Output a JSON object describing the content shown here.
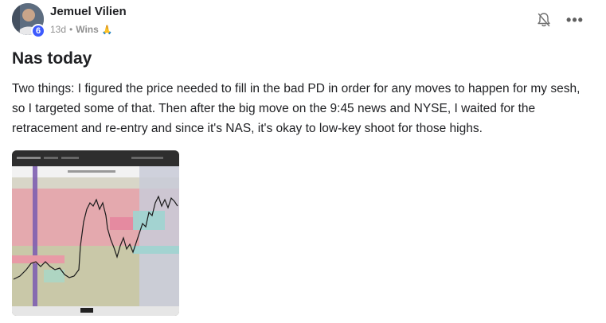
{
  "post": {
    "author": {
      "name": "Jemuel Vilien",
      "level": "6"
    },
    "meta": {
      "time": "13d",
      "separator": "•",
      "category": "Wins",
      "category_emoji": "🙏"
    },
    "icons": {
      "bell": "bell-off-icon",
      "more": "more-horizontal-icon"
    },
    "more_label": "•••",
    "title": "Nas today",
    "body": "Two things: I figured the price needed to fill in the bad PD in order for any moves to happen for my sesh, so I targeted some of that. Then after the big move on the 9:45 news and NYSE, I waited for the retracement and re-entry and since it's NAS, it's okay to low-key shoot for those highs.",
    "attachment": {
      "type": "chart-screenshot"
    }
  },
  "colors": {
    "level_badge": "#3d5afe",
    "text": "#202124",
    "muted": "#909090"
  }
}
